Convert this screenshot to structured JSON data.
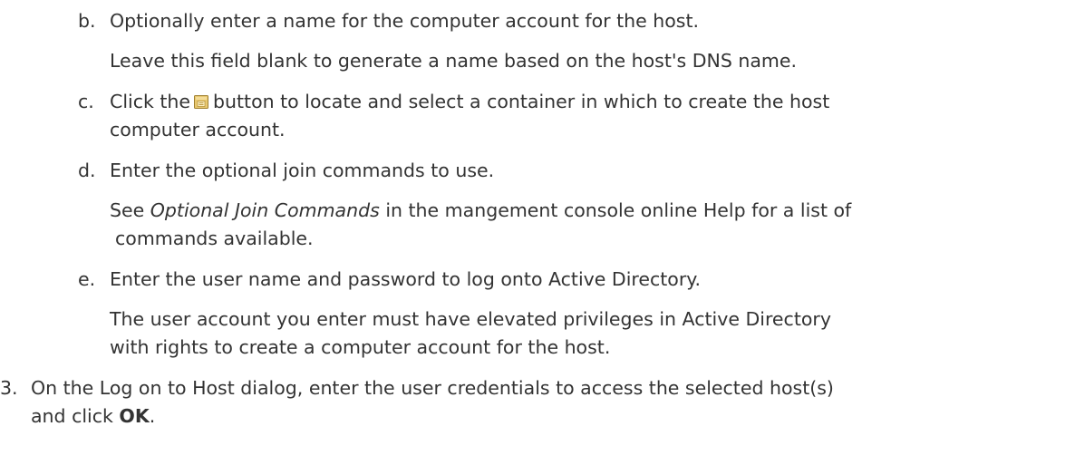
{
  "steps": {
    "b": {
      "marker": "b.",
      "text": "Optionally enter a name for the computer account for the host.",
      "note": "Leave this field blank to generate a name based on the host's DNS name."
    },
    "c": {
      "marker": "c.",
      "text_before_icon": "Click the",
      "icon": "container-browse-icon",
      "text_after_icon": "button to locate and select a container in which to create the host",
      "text_line2": "computer account."
    },
    "d": {
      "marker": "d.",
      "text": "Enter the optional join commands to use.",
      "note_prefix": "See ",
      "note_italic": "Optional Join Commands",
      "note_suffix": " in the mangement console online Help for a list of",
      "note_line2": "commands available."
    },
    "e": {
      "marker": "e.",
      "text": "Enter the user name and password to log onto Active Directory.",
      "note_line1": "The user account you enter must have elevated privileges in Active Directory",
      "note_line2": "with rights to create a computer account for the host."
    },
    "step3": {
      "marker": "3.",
      "text_line1": "On the Log on to Host dialog, enter the user credentials to access the selected host(s)",
      "text_line2_prefix": "and click ",
      "text_line2_bold": "OK",
      "text_line2_suffix": "."
    }
  },
  "colors": {
    "text": "#333333",
    "icon_body": "#e8c870",
    "icon_border": "#a08030"
  }
}
